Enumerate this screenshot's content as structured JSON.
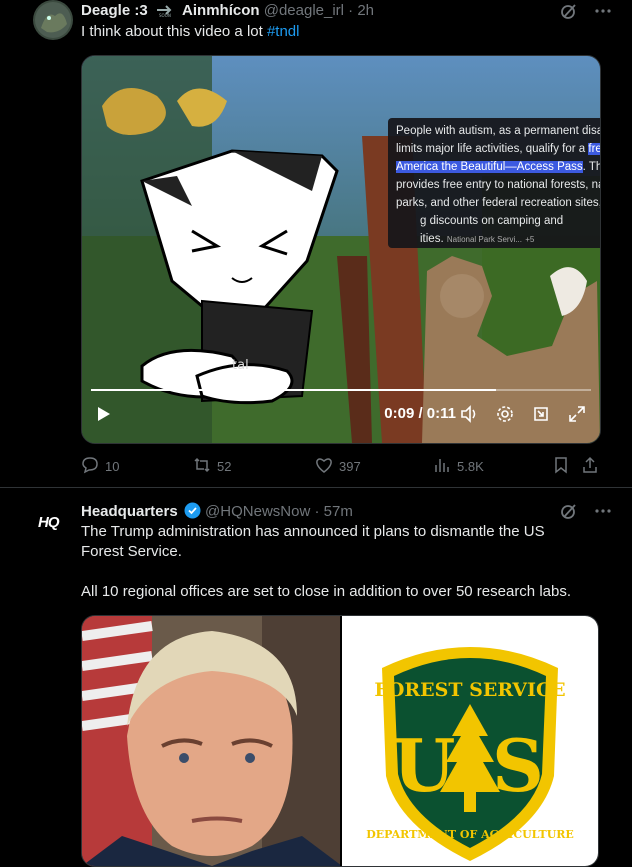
{
  "post1": {
    "author_name": "Deagle :3",
    "author_name_suffix": "Ainmhícon",
    "handle": "@deagle_irl",
    "separator": "·",
    "time": "2h",
    "text": "I think about this video a lot",
    "hashtag": "#tndl",
    "video": {
      "caption_lines": [
        "People with autism, as a permanent disability that",
        "limits major life activities, qualify for a",
        "free lifetime",
        "America the Beautiful—Access Pass",
        ". This pass",
        "provides free entry to national forests, national",
        "parks, and other federal recreation sites, often",
        "g discounts on camping and",
        "ities.",
        "National Park Servi...",
        "+5"
      ],
      "shirt_text": "tal",
      "timecode": "0:09 / 0:11",
      "progress": 0.81
    },
    "replies": "10",
    "reposts": "52",
    "likes": "397",
    "views": "5.8K"
  },
  "post2": {
    "badge": "HQ",
    "author_name": "Headquarters",
    "handle": "@HQNewsNow",
    "separator": "·",
    "time": "57m",
    "text_line1": "The Trump administration has announced it plans to dismantle the US",
    "text_line2": "Forest Service.",
    "text_line3": "All 10 regional offices are set to close in addition to over 50 research labs.",
    "logo": {
      "top_text": "FOREST SERVICE",
      "letter_u": "U",
      "letter_s": "S",
      "bottom_text": "DEPARTMENT OF AGRICULTURE"
    }
  },
  "colors": {
    "background": "#000000",
    "text": "#e7e9ea",
    "muted": "#71767b",
    "link": "#1d9bf0",
    "verified": "#1d9bf0",
    "forest_green": "#0b5130",
    "forest_gold": "#f2c500"
  },
  "icons": [
    "grok-icon",
    "more-icon",
    "reply-icon",
    "repost-icon",
    "like-icon",
    "views-icon",
    "bookmark-icon",
    "share-icon",
    "play-icon",
    "volume-icon",
    "settings-icon",
    "pip-icon",
    "fullscreen-icon",
    "verified-icon"
  ]
}
